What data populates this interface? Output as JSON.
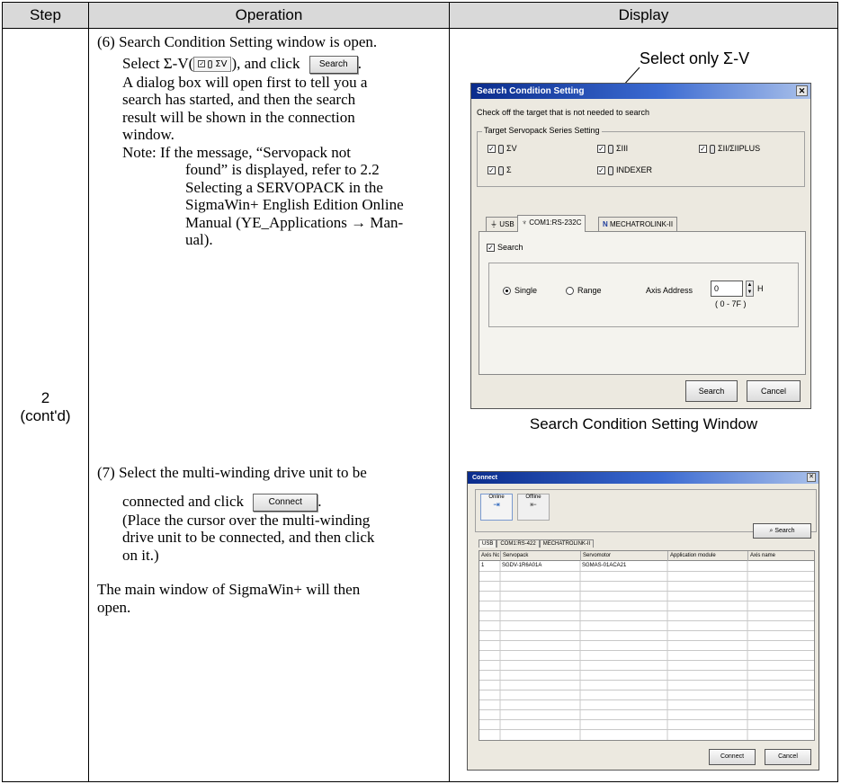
{
  "table": {
    "headers": {
      "step": "Step",
      "operation": "Operation",
      "display": "Display"
    },
    "step": {
      "number": "2",
      "cont": "(cont'd)"
    }
  },
  "op6": {
    "line1": "(6) Search Condition Setting window is open.",
    "select_prefix": "Select Σ-V(",
    "inline_checkbox_label": "ΣV",
    "select_mid": "), and click",
    "inline_search_button": "Search",
    "select_end": ".",
    "body": [
      "A dialog box will open first to tell you a",
      "search has started, and then the search",
      "result will be shown in the connection",
      "window."
    ],
    "note_first": "Note: If the message, “Servopack not",
    "note_rest": [
      "found” is displayed, refer to 2.2",
      "Selecting a SERVOPACK in the",
      "SigmaWin+ English Edition Online",
      "Manual (YE_Applications → Man-",
      "ual)."
    ]
  },
  "op7": {
    "line1": "(7) Select the multi-winding drive unit to be",
    "line2_prefix": "connected and click",
    "inline_connect_button": "Connect",
    "line2_end": ".",
    "paren": [
      "(Place the cursor over the multi-winding",
      "drive unit to be connected, and then click",
      "on it.)"
    ],
    "main": [
      "The main window of SigmaWin+ will then",
      "open."
    ]
  },
  "annotation": "Select only Σ-V",
  "search_window": {
    "title": "Search Condition Setting",
    "close": "✕",
    "instruction": "Check off the target that is not needed to search",
    "group_label": "Target Servopack Series Setting",
    "series": [
      "ΣV",
      "ΣIII",
      "ΣII/ΣIIPLUS",
      "Σ",
      "INDEXER"
    ],
    "tabs": [
      "USB",
      "COM1:RS-232C",
      "MECHATROLINK-II"
    ],
    "search_check": "Search",
    "radio_single": "Single",
    "radio_range": "Range",
    "axis_label": "Axis Address",
    "axis_value": "0",
    "axis_unit": "H",
    "axis_range": "( 0 - 7F )",
    "search_button": "Search",
    "cancel_button": "Cancel"
  },
  "search_caption": "Search Condition Setting Window",
  "connect_window": {
    "title": "Connect",
    "close": "✕",
    "online": "Online",
    "offline": "Offline",
    "search_button": "Search",
    "tabs": [
      "USB",
      "COM1:RS-422",
      "MECHATROLINK-II"
    ],
    "columns": [
      "Axis No.",
      "Servopack",
      "Servomotor",
      "Application module",
      "Axis name"
    ],
    "rows": [
      [
        "1",
        "SGDV-1R6A01A",
        "SGMAS-01ACA21",
        "",
        ""
      ]
    ],
    "connect_button": "Connect",
    "cancel_button": "Cancel"
  }
}
